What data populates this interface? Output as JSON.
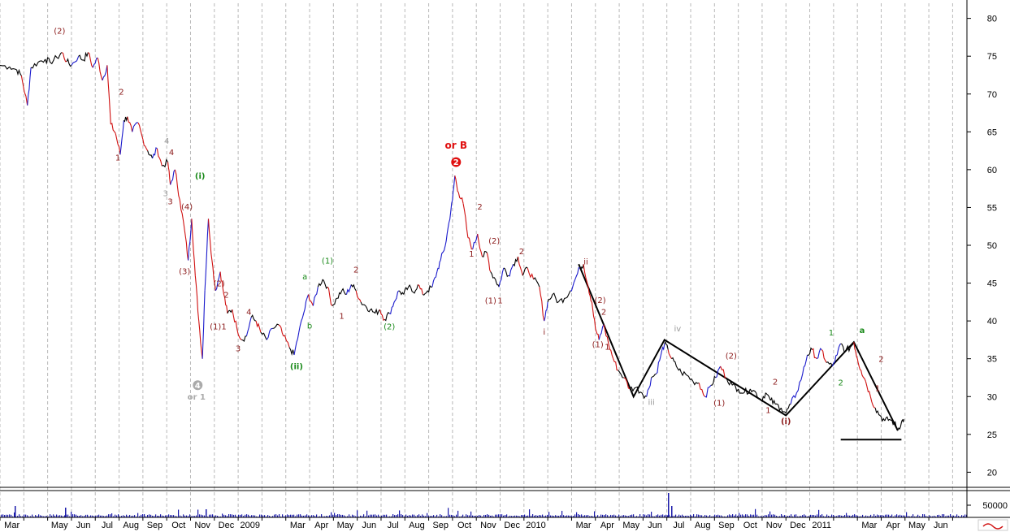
{
  "chart_data": {
    "type": "line",
    "title": "",
    "xlabel": "",
    "ylabel": "",
    "ylim": [
      18,
      82
    ],
    "grid": "vertical-dashed",
    "y_ticks": [
      80,
      75,
      70,
      65,
      60,
      55,
      50,
      45,
      40,
      35,
      30,
      25,
      20
    ],
    "x_ticks": [
      "Mar",
      "May",
      "Jun",
      "Jul",
      "Aug",
      "Sep",
      "Oct",
      "Nov",
      "Dec",
      "2009",
      "Mar",
      "Apr",
      "May",
      "Jun",
      "Jul",
      "Aug",
      "Sep",
      "Oct",
      "Nov",
      "Dec",
      "2010",
      "Mar",
      "Apr",
      "May",
      "Jun",
      "Jul",
      "Aug",
      "Sep",
      "Oct",
      "Nov",
      "Dec",
      "2011",
      "Mar",
      "Apr",
      "May",
      "Jun"
    ],
    "x_tick_t": [
      0.5,
      2.5,
      3.5,
      4.5,
      5.5,
      6.5,
      7.5,
      8.5,
      9.5,
      10.5,
      12.5,
      13.5,
      14.5,
      15.5,
      16.5,
      17.5,
      18.5,
      19.5,
      20.5,
      21.5,
      22.5,
      24.5,
      25.5,
      26.5,
      27.5,
      28.5,
      29.5,
      30.5,
      31.5,
      32.5,
      33.5,
      34.5,
      36.5,
      37.5,
      38.5,
      39.5
    ],
    "series": [
      {
        "values": [
          [
            0.0,
            73.8
          ],
          [
            0.4,
            73.6
          ],
          [
            0.7,
            73.2
          ],
          [
            0.9,
            72.4
          ],
          [
            1.15,
            68.5
          ],
          [
            1.3,
            73.5
          ],
          [
            1.6,
            74.2
          ],
          [
            1.9,
            74.6
          ],
          [
            2.1,
            74.2
          ],
          [
            2.4,
            74.8
          ],
          [
            2.6,
            75.5
          ],
          [
            2.8,
            74.3
          ],
          [
            3.0,
            73.8
          ],
          [
            3.3,
            75.0
          ],
          [
            3.5,
            74.5
          ],
          [
            3.7,
            75.5
          ],
          [
            3.9,
            73.5
          ],
          [
            4.1,
            74.8
          ],
          [
            4.3,
            71.8
          ],
          [
            4.5,
            73.8
          ],
          [
            4.65,
            66.0
          ],
          [
            4.85,
            64.8
          ],
          [
            5.05,
            62.0
          ],
          [
            5.2,
            66.5
          ],
          [
            5.35,
            67.0
          ],
          [
            5.55,
            65.0
          ],
          [
            5.8,
            66.2
          ],
          [
            6.0,
            64.0
          ],
          [
            6.2,
            62.5
          ],
          [
            6.4,
            61.5
          ],
          [
            6.6,
            62.8
          ],
          [
            6.8,
            60.5
          ],
          [
            7.05,
            61.0
          ],
          [
            7.15,
            58.0
          ],
          [
            7.35,
            60.0
          ],
          [
            7.55,
            56.0
          ],
          [
            7.75,
            52.0
          ],
          [
            7.9,
            48.0
          ],
          [
            8.05,
            53.5
          ],
          [
            8.2,
            46.0
          ],
          [
            8.35,
            40.0
          ],
          [
            8.5,
            35.0
          ],
          [
            8.6,
            44.0
          ],
          [
            8.75,
            53.5
          ],
          [
            8.9,
            48.0
          ],
          [
            9.05,
            44.0
          ],
          [
            9.25,
            46.5
          ],
          [
            9.4,
            43.5
          ],
          [
            9.55,
            41.0
          ],
          [
            9.75,
            41.5
          ],
          [
            9.95,
            39.0
          ],
          [
            10.15,
            37.5
          ],
          [
            10.35,
            38.0
          ],
          [
            10.55,
            40.5
          ],
          [
            10.75,
            40.0
          ],
          [
            10.95,
            38.5
          ],
          [
            11.2,
            37.5
          ],
          [
            11.45,
            39.0
          ],
          [
            11.7,
            39.5
          ],
          [
            11.9,
            38.0
          ],
          [
            12.15,
            36.5
          ],
          [
            12.35,
            35.5
          ],
          [
            12.55,
            38.5
          ],
          [
            12.75,
            41.0
          ],
          [
            12.95,
            43.5
          ],
          [
            13.15,
            42.0
          ],
          [
            13.35,
            44.5
          ],
          [
            13.55,
            45.5
          ],
          [
            13.75,
            44.5
          ],
          [
            13.95,
            42.0
          ],
          [
            14.15,
            43.0
          ],
          [
            14.35,
            44.0
          ],
          [
            14.55,
            43.5
          ],
          [
            14.75,
            44.8
          ],
          [
            14.95,
            44.0
          ],
          [
            15.15,
            42.5
          ],
          [
            15.35,
            42.0
          ],
          [
            15.55,
            41.5
          ],
          [
            15.75,
            41.0
          ],
          [
            15.95,
            41.5
          ],
          [
            16.15,
            40.2
          ],
          [
            16.35,
            41.0
          ],
          [
            16.55,
            42.5
          ],
          [
            16.75,
            44.0
          ],
          [
            16.95,
            43.5
          ],
          [
            17.15,
            44.5
          ],
          [
            17.35,
            43.8
          ],
          [
            17.55,
            44.8
          ],
          [
            17.75,
            43.5
          ],
          [
            17.95,
            44.0
          ],
          [
            18.15,
            44.5
          ],
          [
            18.35,
            46.5
          ],
          [
            18.5,
            48.0
          ],
          [
            18.7,
            50.0
          ],
          [
            18.85,
            53.0
          ],
          [
            19.0,
            56.0
          ],
          [
            19.1,
            59.2
          ],
          [
            19.25,
            57.0
          ],
          [
            19.45,
            55.5
          ],
          [
            19.65,
            51.0
          ],
          [
            19.85,
            49.5
          ],
          [
            20.05,
            51.5
          ],
          [
            20.25,
            48.5
          ],
          [
            20.45,
            49.0
          ],
          [
            20.6,
            46.5
          ],
          [
            20.8,
            45.5
          ],
          [
            20.95,
            44.5
          ],
          [
            21.15,
            47.0
          ],
          [
            21.35,
            46.0
          ],
          [
            21.55,
            47.5
          ],
          [
            21.75,
            48.5
          ],
          [
            21.95,
            46.0
          ],
          [
            22.15,
            47.0
          ],
          [
            22.4,
            45.5
          ],
          [
            22.65,
            44.5
          ],
          [
            22.85,
            40.0
          ],
          [
            23.0,
            42.5
          ],
          [
            23.2,
            43.5
          ],
          [
            23.45,
            42.5
          ],
          [
            23.7,
            43.0
          ],
          [
            23.95,
            44.0
          ],
          [
            24.15,
            45.5
          ],
          [
            24.35,
            47.0
          ],
          [
            24.5,
            47.5
          ],
          [
            24.7,
            44.5
          ],
          [
            24.85,
            42.5
          ],
          [
            25.0,
            39.0
          ],
          [
            25.15,
            37.5
          ],
          [
            25.35,
            39.5
          ],
          [
            25.55,
            37.0
          ],
          [
            25.75,
            35.0
          ],
          [
            25.95,
            33.5
          ],
          [
            26.2,
            32.5
          ],
          [
            26.45,
            31.0
          ],
          [
            26.7,
            31.2
          ],
          [
            26.95,
            30.5
          ],
          [
            27.15,
            30.0
          ],
          [
            27.35,
            32.5
          ],
          [
            27.55,
            33.0
          ],
          [
            27.75,
            35.5
          ],
          [
            27.9,
            37.0
          ],
          [
            28.05,
            36.2
          ],
          [
            28.2,
            35.0
          ],
          [
            28.4,
            34.0
          ],
          [
            28.6,
            33.2
          ],
          [
            28.85,
            32.8
          ],
          [
            29.1,
            32.0
          ],
          [
            29.35,
            31.8
          ],
          [
            29.6,
            30.0
          ],
          [
            29.85,
            31.5
          ],
          [
            30.05,
            32.5
          ],
          [
            30.25,
            34.0
          ],
          [
            30.5,
            32.5
          ],
          [
            30.75,
            31.5
          ],
          [
            31.0,
            31.0
          ],
          [
            31.25,
            30.5
          ],
          [
            31.5,
            31.0
          ],
          [
            31.75,
            30.5
          ],
          [
            31.95,
            29.5
          ],
          [
            32.15,
            30.5
          ],
          [
            32.35,
            29.5
          ],
          [
            32.55,
            29.0
          ],
          [
            32.8,
            28.5
          ],
          [
            33.0,
            27.8
          ],
          [
            33.2,
            29.0
          ],
          [
            33.45,
            30.5
          ],
          [
            33.7,
            33.0
          ],
          [
            33.9,
            35.5
          ],
          [
            34.1,
            36.2
          ],
          [
            34.3,
            35.0
          ],
          [
            34.5,
            36.2
          ],
          [
            34.7,
            34.5
          ],
          [
            34.95,
            34.0
          ],
          [
            35.15,
            35.5
          ],
          [
            35.3,
            37.0
          ],
          [
            35.5,
            36.0
          ],
          [
            35.7,
            36.5
          ],
          [
            35.85,
            37.2
          ],
          [
            36.0,
            35.0
          ],
          [
            36.15,
            33.5
          ],
          [
            36.35,
            32.0
          ],
          [
            36.55,
            30.0
          ],
          [
            36.75,
            28.5
          ],
          [
            36.95,
            27.5
          ],
          [
            37.15,
            26.8
          ],
          [
            37.35,
            27.0
          ],
          [
            37.55,
            26.5
          ],
          [
            37.7,
            25.6
          ],
          [
            37.85,
            26.6
          ],
          [
            37.95,
            27.0
          ]
        ]
      }
    ],
    "trend_lines": [
      [
        [
          24.3,
          47.5
        ],
        [
          26.6,
          30.0
        ],
        [
          27.9,
          37.5
        ],
        [
          33.0,
          27.5
        ],
        [
          35.85,
          37.2
        ],
        [
          37.7,
          25.5
        ]
      ],
      [
        [
          35.3,
          24.3
        ],
        [
          37.85,
          24.3
        ]
      ]
    ],
    "volume_label": "50000",
    "annotations": [
      {
        "text": "(2)",
        "t": 2.5,
        "y": 78.0,
        "color": "#8b1a1a"
      },
      {
        "text": "2",
        "t": 5.1,
        "y": 69.9,
        "color": "#8b1a1a"
      },
      {
        "text": "1",
        "t": 4.95,
        "y": 61.2,
        "color": "#8b1a1a"
      },
      {
        "text": "4",
        "t": 7.0,
        "y": 63.4,
        "color": "#999999"
      },
      {
        "text": "4",
        "t": 7.2,
        "y": 61.9,
        "color": "#8b1a1a"
      },
      {
        "text": "3",
        "t": 6.95,
        "y": 56.5,
        "color": "#999999"
      },
      {
        "text": "3",
        "t": 7.15,
        "y": 55.4,
        "color": "#8b1a1a"
      },
      {
        "text": "(i)",
        "t": 8.4,
        "y": 58.8,
        "color": "#1a8a1a",
        "bold": true
      },
      {
        "text": "(4)",
        "t": 7.85,
        "y": 54.7,
        "color": "#8b1a1a"
      },
      {
        "text": "(3)",
        "t": 7.75,
        "y": 46.2,
        "color": "#8b1a1a"
      },
      {
        "text": "(2)",
        "t": 9.2,
        "y": 44.6,
        "color": "#8b1a1a"
      },
      {
        "text": "2",
        "t": 9.5,
        "y": 43.1,
        "color": "#8b1a1a"
      },
      {
        "text": "(1)",
        "t": 9.05,
        "y": 38.9,
        "color": "#8b1a1a"
      },
      {
        "text": "1",
        "t": 9.4,
        "y": 38.9,
        "color": "#8b1a1a"
      },
      {
        "text": "3",
        "t": 10.0,
        "y": 36.0,
        "color": "#8b1a1a"
      },
      {
        "text": "4",
        "t": 10.45,
        "y": 40.8,
        "color": "#8b1a1a"
      },
      {
        "text": "or 1",
        "t": 8.25,
        "y": 29.6,
        "color": "#aaaaaa",
        "bold": true
      },
      {
        "text": "(ii)",
        "t": 12.45,
        "y": 33.6,
        "color": "#1a8a1a",
        "bold": true
      },
      {
        "text": "a",
        "t": 12.8,
        "y": 45.5,
        "color": "#1a8a1a"
      },
      {
        "text": "b",
        "t": 13.0,
        "y": 39.0,
        "color": "#1a8a1a"
      },
      {
        "text": "(1)",
        "t": 13.75,
        "y": 47.6,
        "color": "#1a8a1a"
      },
      {
        "text": "2",
        "t": 14.95,
        "y": 46.4,
        "color": "#8b1a1a"
      },
      {
        "text": "1",
        "t": 14.35,
        "y": 40.3,
        "color": "#8b1a1a"
      },
      {
        "text": "(2)",
        "t": 16.35,
        "y": 38.9,
        "color": "#1a8a1a"
      },
      {
        "text": "or B",
        "t": 19.15,
        "y": 62.8,
        "color": "#e01010",
        "bold": true,
        "big": true
      },
      {
        "text": "2",
        "t": 20.15,
        "y": 54.7,
        "color": "#8b1a1a"
      },
      {
        "text": "1",
        "t": 19.8,
        "y": 48.5,
        "color": "#8b1a1a"
      },
      {
        "text": "(2)",
        "t": 20.75,
        "y": 50.2,
        "color": "#8b1a1a"
      },
      {
        "text": "2",
        "t": 21.9,
        "y": 48.8,
        "color": "#8b1a1a"
      },
      {
        "text": "(1)",
        "t": 20.6,
        "y": 42.3,
        "color": "#8b1a1a"
      },
      {
        "text": "1",
        "t": 21.0,
        "y": 42.3,
        "color": "#8b1a1a"
      },
      {
        "text": "i",
        "t": 22.85,
        "y": 38.2,
        "color": "#8b1a1a"
      },
      {
        "text": "ii",
        "t": 24.6,
        "y": 47.5,
        "color": "#8b1a1a"
      },
      {
        "text": "(2)",
        "t": 25.2,
        "y": 42.4,
        "color": "#8b1a1a"
      },
      {
        "text": "2",
        "t": 25.35,
        "y": 40.8,
        "color": "#8b1a1a"
      },
      {
        "text": "(1)",
        "t": 25.1,
        "y": 36.5,
        "color": "#8b1a1a"
      },
      {
        "text": "1",
        "t": 25.5,
        "y": 36.2,
        "color": "#8b1a1a"
      },
      {
        "text": "iii",
        "t": 27.35,
        "y": 28.9,
        "color": "#999999"
      },
      {
        "text": "iv",
        "t": 28.45,
        "y": 38.6,
        "color": "#999999"
      },
      {
        "text": "(2)",
        "t": 30.7,
        "y": 35.0,
        "color": "#8b1a1a"
      },
      {
        "text": "(1)",
        "t": 30.2,
        "y": 28.8,
        "color": "#8b1a1a"
      },
      {
        "text": "2",
        "t": 32.55,
        "y": 31.6,
        "color": "#8b1a1a"
      },
      {
        "text": "1",
        "t": 32.25,
        "y": 27.8,
        "color": "#8b1a1a"
      },
      {
        "text": "(i)",
        "t": 33.0,
        "y": 26.4,
        "color": "#8b1a1a",
        "bold": true
      },
      {
        "text": "1",
        "t": 34.9,
        "y": 38.1,
        "color": "#1a8a1a"
      },
      {
        "text": "2",
        "t": 35.3,
        "y": 31.5,
        "color": "#1a8a1a"
      },
      {
        "text": "a",
        "t": 36.2,
        "y": 38.4,
        "color": "#1a8a1a",
        "bold": true
      },
      {
        "text": "2",
        "t": 37.0,
        "y": 34.6,
        "color": "#8b1a1a"
      },
      {
        "text": "1",
        "t": 36.85,
        "y": 30.7,
        "color": "#8b1a1a"
      }
    ],
    "circle_markers": [
      {
        "text": "2",
        "t": 19.15,
        "y": 61.0,
        "fill": "#e01010"
      },
      {
        "text": "4",
        "t": 8.3,
        "y": 31.5,
        "fill": "#aaaaaa"
      }
    ]
  }
}
